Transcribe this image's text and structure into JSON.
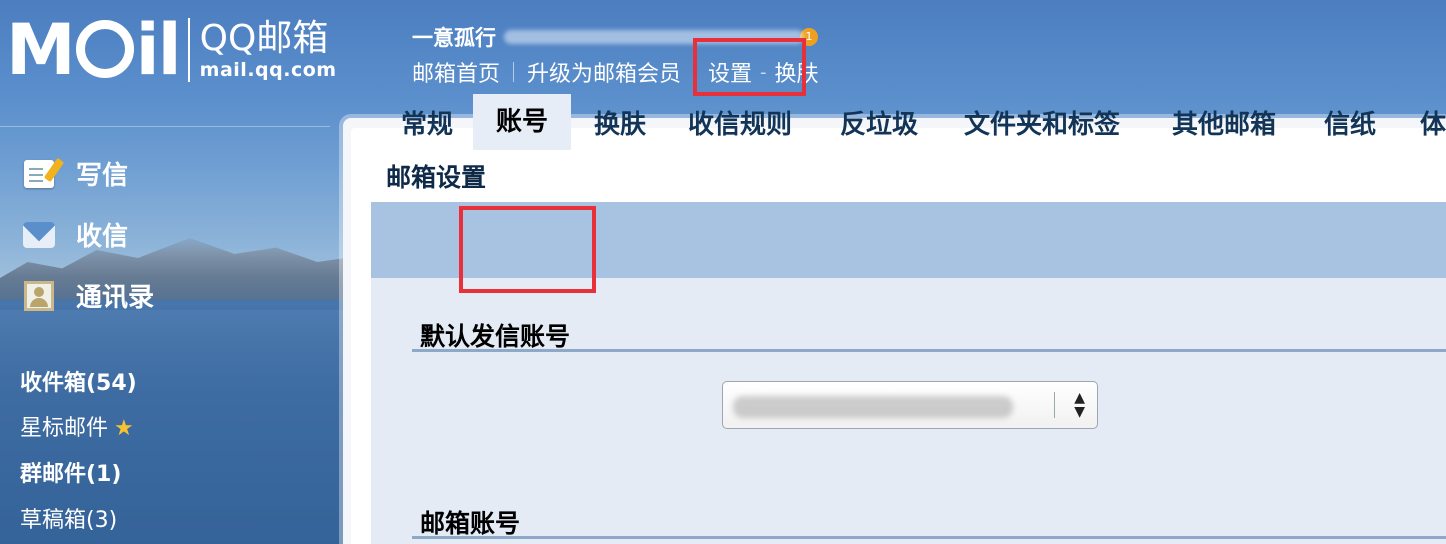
{
  "logo": {
    "brand": "MOil",
    "cn": "QQ邮箱",
    "url": "mail.qq.com"
  },
  "user": {
    "name": "一意孤行",
    "coin": "1"
  },
  "top_links": {
    "home": "邮箱首页",
    "upgrade": "升级为邮箱会员",
    "settings": "设置",
    "skin": "换肤",
    "dash": "-"
  },
  "nav": {
    "write": "写信",
    "inbox": "收信",
    "contacts": "通讯录"
  },
  "folders": {
    "inbox": "收件箱(54)",
    "starred": "星标邮件",
    "starred_icon": "★",
    "group": "群邮件(1)",
    "drafts": "草稿箱(3)"
  },
  "settings": {
    "title": "邮箱设置",
    "tabs": [
      "常规",
      "账号",
      "换肤",
      "收信规则",
      "反垃圾",
      "文件夹和标签",
      "其他邮箱",
      "信纸",
      "体"
    ],
    "active_tab": "账号",
    "section_default_sender": "默认发信账号",
    "section_mail_account": "邮箱账号",
    "select_arrows": "▲\n▼"
  },
  "colors": {
    "highlight": "#e8303a",
    "accent": "#f0a020",
    "tab_bar": "#a8c3e2"
  }
}
